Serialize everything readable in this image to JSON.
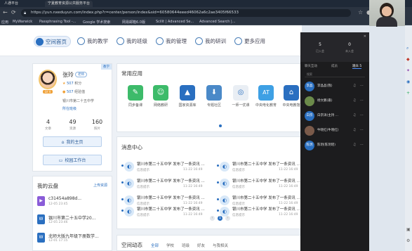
{
  "browser": {
    "tabs": [
      "人通平台",
      "宁夏教育资源公共服务平台"
    ],
    "url": "https://yun.nxeduyun.com/index.php?r=center/person/index&sid=60580644eeed46062a6c2ae3405f66533",
    "bookmarks": [
      "应用",
      "MyWarwick",
      "Passphrasing Tool -...",
      "Google 学术搜索",
      "网易邮箱6.0版",
      "Scilit | Advanced Se...",
      "Advanced Search |..."
    ]
  },
  "nav": [
    {
      "label": "空间首页",
      "icon": "home-icon",
      "active": true
    },
    {
      "label": "我的教学",
      "icon": "teach-icon",
      "active": false
    },
    {
      "label": "我的班级",
      "icon": "class-icon",
      "active": false
    },
    {
      "label": "我的管理",
      "icon": "manage-icon",
      "active": false
    },
    {
      "label": "我的研训",
      "icon": "research-icon",
      "active": false
    },
    {
      "label": "更多应用",
      "icon": "more-icon",
      "active": false
    }
  ],
  "profile": {
    "name": "张玲",
    "role": "老师",
    "tag": "教学",
    "level": "LV 4",
    "exp1": "507",
    "exp1_label": "积分",
    "exp2": "507",
    "exp2_label": "经验值",
    "school": "银川市第二十五中学",
    "group": "所在班级",
    "stats": [
      {
        "n": "4",
        "l": "文章"
      },
      {
        "n": "49",
        "l": "资源"
      },
      {
        "n": "160",
        "l": "照片"
      }
    ],
    "btn_home": "我的主页",
    "btn_school": "校园工作台"
  },
  "cloud": {
    "title": "我的云盘",
    "upload": "上传资源",
    "files": [
      {
        "name": "c31454a898d...",
        "date": "12-05  23:45",
        "type": "video",
        "color": "#8a5cd8",
        "glyph": "▶"
      },
      {
        "name": "银川市第二十五中学20...",
        "date": "12-05  23:46",
        "type": "word",
        "color": "#2a6fc0",
        "glyph": "W"
      },
      {
        "name": "北师大版九年级下册数学...",
        "date": "12-01  17:15",
        "type": "word",
        "color": "#2a6fc0",
        "glyph": "W"
      }
    ]
  },
  "apps": {
    "title": "常用应用",
    "items": [
      {
        "label": "同步备课",
        "color": "#3dbb6a",
        "glyph": "✎"
      },
      {
        "label": "网络教研",
        "color": "#3dbb6a",
        "glyph": "☺"
      },
      {
        "label": "国家资源库",
        "color": "#2a6fc0",
        "glyph": "▲"
      },
      {
        "label": "专题社区",
        "color": "#4a89c8",
        "glyph": "⬇"
      },
      {
        "label": "一师一优课",
        "color": "#e9eef4",
        "glyph": "◎"
      },
      {
        "label": "中央电化教育",
        "color": "#3ea0e4",
        "glyph": "AT"
      },
      {
        "label": "中央电教馆",
        "color": "#2a6fc0",
        "glyph": "⌂"
      }
    ]
  },
  "messages": {
    "title": "消息中心",
    "items": [
      {
        "text": "银川市第二十五中学 发布了一条资讯 ...",
        "src": "信息提示",
        "date": "11-22 16:49"
      },
      {
        "text": "银川市第二十五中学 发布了一条资讯 ...",
        "src": "信息提示",
        "date": "11-22 16:49"
      },
      {
        "text": "银川市第二十五中学 发布了一条资讯 ...",
        "src": "信息提示",
        "date": "11-22 16:49"
      },
      {
        "text": "银川市第二十五中学 发布了一条资讯 ...",
        "src": "信息提示",
        "date": "11-22 16:49"
      },
      {
        "text": "银川市第二十五中学 发布了一条资讯 ...",
        "src": "信息提示",
        "date": "11-22 16:49"
      },
      {
        "text": "银川市第二十五中学 发布了一条资讯 ...",
        "src": "信息提示",
        "date": "11-22 16:49"
      },
      {
        "text": "银川市第二十五中学 发布了一条资讯 ...",
        "src": "信息提示",
        "date": "11-22 16:49"
      },
      {
        "text": "银川市第二十五中学 发布了一条资讯 ...",
        "src": "信息提示",
        "date": "11-22 16:49"
      }
    ],
    "pages": [
      "‹",
      "1",
      "›"
    ]
  },
  "dynamics": {
    "title": "空间动态",
    "tabs": [
      "全部",
      "学校",
      "班级",
      "好友",
      "与我相关"
    ]
  },
  "meeting": {
    "stats": [
      {
        "n": "5",
        "l": "已入会"
      },
      {
        "n": "0",
        "l": "未入会"
      }
    ],
    "tabs": [
      "聊天互动",
      "成员",
      "观众 5"
    ],
    "search": "搜索",
    "members": [
      {
        "name": "李晶晶(我)",
        "avatar": "李晶",
        "color": "#2a6fc0"
      },
      {
        "name": "杨文鹏(嘉)",
        "avatar": "",
        "color": "#6b8a4a"
      },
      {
        "name": "白宗涛(主持 ...",
        "avatar": "白宗",
        "color": "#2a6fc0"
      },
      {
        "name": "牛晓红(牛晓红)",
        "avatar": "",
        "color": "#7a5a4a"
      },
      {
        "name": "陈玥(陈玥瑶)",
        "avatar": "陈玥",
        "color": "#2a6fc0"
      }
    ]
  }
}
